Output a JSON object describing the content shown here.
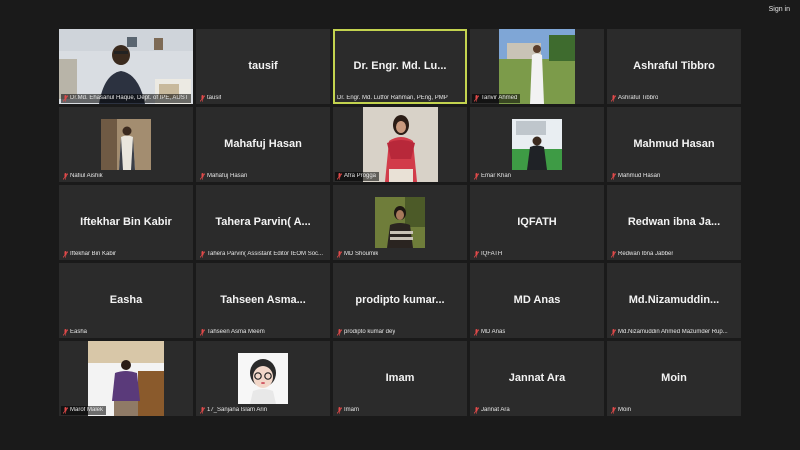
{
  "topbar": {
    "signin_label": "Sign in"
  },
  "colors": {
    "tile_bg": "#2b2b2b",
    "page_bg": "#1a1a1a",
    "active_speaker_border": "#c3d34f",
    "mic_muted": "#e24a4a"
  },
  "participants": [
    {
      "name": "",
      "label": "Dr.Md. Ehasanul Haque, Dept. of IPE, AUST",
      "video": true,
      "photo": "man-at-desk"
    },
    {
      "name": "tausif",
      "label": "tausif",
      "video": false
    },
    {
      "name": "Dr. Engr. Md. Lu...",
      "label": "Dr. Engr. Md. Lutfor Rahman, PEng, PMP",
      "video": false,
      "active": true
    },
    {
      "name": "",
      "label": "Tanvir Ahmed",
      "video": true,
      "photo": "man-on-lawn"
    },
    {
      "name": "Ashraful Tibbro",
      "label": "Ashraful Tibbro",
      "video": false
    },
    {
      "name": "",
      "label": "Nafiul Aishik",
      "video": true,
      "photo": "man-in-suit"
    },
    {
      "name": "Mahafuj Hasan",
      "label": "Mahafuj Hasan",
      "video": false
    },
    {
      "name": "",
      "label": "Afra Progga",
      "video": true,
      "photo": "woman-red-dress"
    },
    {
      "name": "",
      "label": "Emar Khan",
      "video": true,
      "photo": "man-at-stadium"
    },
    {
      "name": "Mahmud Hasan",
      "label": "Mahmud Hasan",
      "video": false
    },
    {
      "name": "Iftekhar Bin Kabir",
      "label": "Iftekhar Bin Kabir",
      "video": false
    },
    {
      "name": "Tahera Parvin( A...",
      "label": "Tahera Parvin( Assistant Editor IEOM Soc...",
      "video": false
    },
    {
      "name": "",
      "label": "MD Shoumik",
      "video": true,
      "photo": "young-man"
    },
    {
      "name": "IQFATH",
      "label": "IQFATH",
      "video": false
    },
    {
      "name": "Redwan ibna Ja...",
      "label": "Redwan Ibna Jabber",
      "video": false
    },
    {
      "name": "Easha",
      "label": "Easha",
      "video": false
    },
    {
      "name": "Tahseen Asma...",
      "label": "Tahseen Asma Meem",
      "video": false
    },
    {
      "name": "prodipto kumar...",
      "label": "prodipto kumar dey",
      "video": false
    },
    {
      "name": "MD Anas",
      "label": "MD Anas",
      "video": false
    },
    {
      "name": "Md.Nizamuddin...",
      "label": "Md.Nizamuddin Ahmed Mazumder Rup...",
      "video": false
    },
    {
      "name": "",
      "label": "Marof Malek",
      "video": true,
      "photo": "man-purple-shirt"
    },
    {
      "name": "",
      "label": "17_Sanjana Islam Arin",
      "video": true,
      "photo": "cartoon-avatar"
    },
    {
      "name": "Imam",
      "label": "Imam",
      "video": false
    },
    {
      "name": "Jannat Ara",
      "label": "Jannat Ara",
      "video": false
    },
    {
      "name": "Moin",
      "label": "Moin",
      "video": false
    }
  ]
}
